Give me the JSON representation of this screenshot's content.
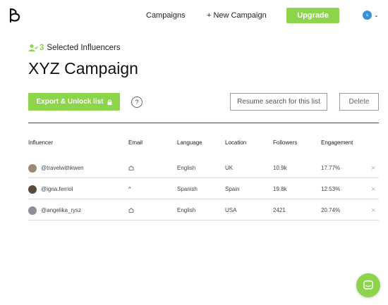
{
  "nav": {
    "logo_icon": "brand-b-logo",
    "campaigns": "Campaigns",
    "new_campaign": "+ New Campaign",
    "upgrade": "Upgrade",
    "avatar_letter": "s",
    "avatar_color": "#3a8fd6"
  },
  "header": {
    "selected_count": "3",
    "selected_label": "Selected Influencers",
    "title": "XYZ Campaign"
  },
  "actions": {
    "export": "Export & Unlock list",
    "help": "?",
    "resume": "Resume search for this list",
    "delete": "Delete"
  },
  "table": {
    "columns": [
      "Influencer",
      "Email",
      "Language",
      "Location",
      "Followers",
      "Engagement"
    ],
    "rows": [
      {
        "handle": "@travelwithkwen",
        "email": "locked",
        "language": "English",
        "location": "UK",
        "followers": "10.9k",
        "engagement": "17.77%",
        "avatar_color": "#9c8a76"
      },
      {
        "handle": "@igna.ferriol",
        "email": "^",
        "language": "Spanish",
        "location": "Spain",
        "followers": "19.8k",
        "engagement": "12.53%",
        "avatar_color": "#5a4a3c"
      },
      {
        "handle": "@angelika_rysz",
        "email": "locked",
        "language": "English",
        "location": "USA",
        "followers": "2421",
        "engagement": "20.74%",
        "avatar_color": "#8a8f98"
      }
    ]
  },
  "colors": {
    "accent": "#8cd44a",
    "divider": "#444444",
    "row_border": "#dcdcdc"
  }
}
